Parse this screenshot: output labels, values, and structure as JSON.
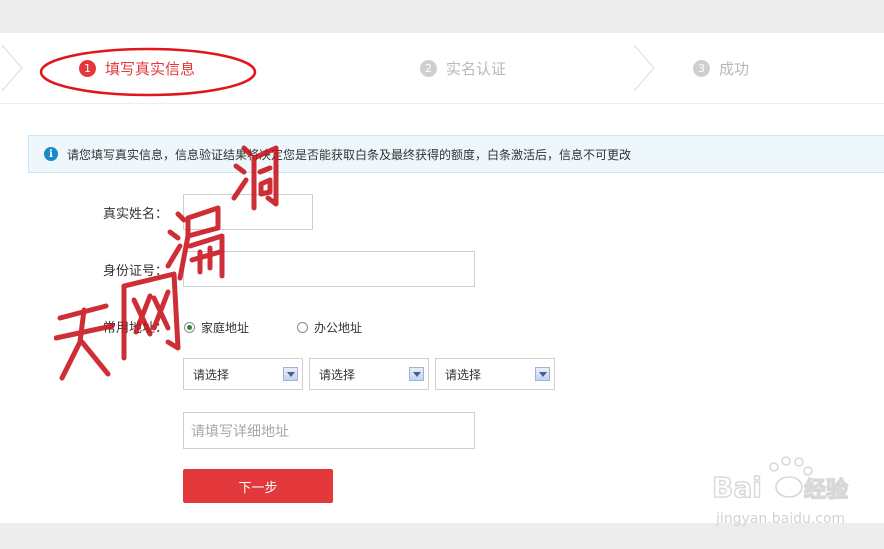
{
  "steps": [
    {
      "num": "1",
      "label": "填写真实信息",
      "state": "active"
    },
    {
      "num": "2",
      "label": "实名认证",
      "state": "inactive"
    },
    {
      "num": "3",
      "label": "成功",
      "state": "inactive"
    }
  ],
  "info": {
    "icon": "info-icon",
    "text": "请您填写真实信息，信息验证结果将决定您是否能获取白条及最终获得的额度，白条激活后，信息不可更改"
  },
  "form": {
    "name_label": "真实姓名：",
    "id_label": "身份证号：",
    "address_label": "常用地址：",
    "radio_home": "家庭地址",
    "radio_office": "办公地址",
    "selected_address_type": "家庭地址",
    "selects": [
      "请选择",
      "请选择",
      "请选择"
    ],
    "detail_placeholder": "请填写详细地址",
    "next_button": "下一步"
  },
  "overlays": {
    "handwritten_watermark": "天网漏洞",
    "baidu_logo": "Baidu经验",
    "baidu_url": "jingyan.baidu.com"
  },
  "colors": {
    "accent_red": "#e4393c",
    "inactive_gray": "#b8b8b8",
    "info_bg": "#eef7fc",
    "info_icon": "#1a88c9"
  }
}
